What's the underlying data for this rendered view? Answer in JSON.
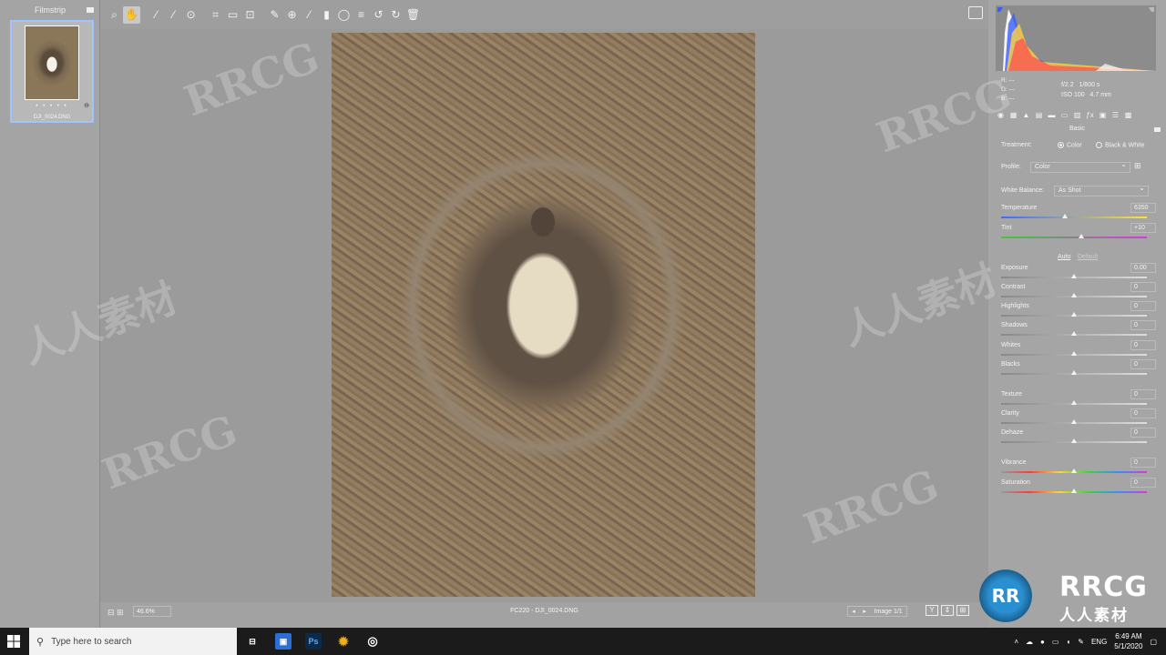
{
  "filmstrip": {
    "title": "Filmstrip",
    "thumb_stars": "• • • • •",
    "thumb_filename": "DJI_0024.DNG"
  },
  "toolbar": {
    "tools": [
      "zoom-icon",
      "hand-icon",
      "white-balance-icon",
      "color-sampler-icon",
      "targeted-adjust-icon",
      "crop-icon",
      "straighten-icon",
      "transform-icon",
      "spot-removal-icon",
      "red-eye-icon",
      "adjustment-brush-icon",
      "graduated-filter-icon",
      "radial-filter-icon",
      "preferences-icon",
      "rotate-left-icon",
      "rotate-right-icon",
      "trash-icon"
    ],
    "active_tool": "hand-icon"
  },
  "bottom": {
    "zoom": "46.6%",
    "file_info": "FC220 - DJI_0024.DNG",
    "image_counter": "Image 1/1",
    "view_buttons": [
      "Y",
      "⇕",
      "⊞"
    ]
  },
  "panel": {
    "rgb": {
      "r": "R:  ---",
      "g": "G:  ---",
      "b": "B:  ---"
    },
    "exif": {
      "aperture": "f/2.2",
      "shutter": "1/800 s",
      "iso": "ISO 100",
      "focal": "4.7 mm"
    },
    "section_title": "Basic",
    "treatment_label": "Treatment:",
    "treatment_options": [
      "Color",
      "Black & White"
    ],
    "treatment_selected": "Color",
    "profile_label": "Profile:",
    "profile_value": "Color",
    "wb_label": "White Balance:",
    "wb_value": "As Shot",
    "auto_label": "Auto",
    "default_label": "Default",
    "sliders": [
      {
        "label": "Temperature",
        "value": "6350",
        "level": 0.44
      },
      {
        "label": "Tint",
        "value": "+10",
        "level": 0.55
      },
      {
        "label": "Exposure",
        "value": "0.00",
        "level": 0.5
      },
      {
        "label": "Contrast",
        "value": "0",
        "level": 0.5
      },
      {
        "label": "Highlights",
        "value": "0",
        "level": 0.5
      },
      {
        "label": "Shadows",
        "value": "0",
        "level": 0.5
      },
      {
        "label": "Whites",
        "value": "0",
        "level": 0.5
      },
      {
        "label": "Blacks",
        "value": "0",
        "level": 0.5
      },
      {
        "label": "Texture",
        "value": "0",
        "level": 0.5
      },
      {
        "label": "Clarity",
        "value": "0",
        "level": 0.5
      },
      {
        "label": "Dehaze",
        "value": "0",
        "level": 0.5
      },
      {
        "label": "Vibrance",
        "value": "0",
        "level": 0.5
      },
      {
        "label": "Saturation",
        "value": "0",
        "level": 0.5
      }
    ]
  },
  "taskbar": {
    "search_placeholder": "Type here to search",
    "time": "6:49 AM",
    "date": "5/1/2020",
    "language": "ENG"
  },
  "logo": {
    "mark": "RR",
    "text": "RRCG",
    "subtext": "人人素材"
  },
  "watermark": {
    "latin": "RRCG",
    "cjk": "人人素材"
  }
}
